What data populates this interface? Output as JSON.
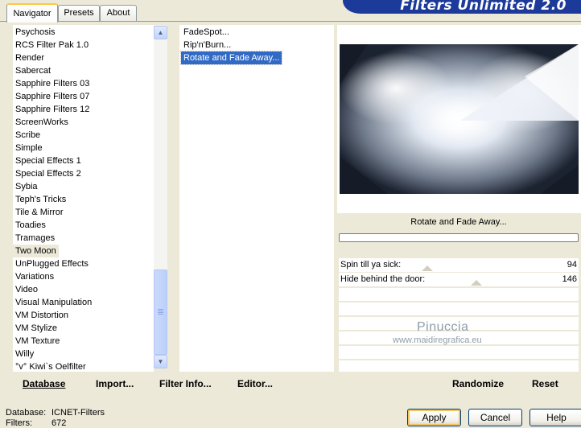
{
  "app": {
    "title": "Filters Unlimited 2.0"
  },
  "tabs": [
    {
      "label": "Navigator",
      "active": true
    },
    {
      "label": "Presets",
      "active": false
    },
    {
      "label": "About",
      "active": false
    }
  ],
  "categories": {
    "items": [
      "Psychosis",
      "RCS Filter Pak 1.0",
      "Render",
      "Sabercat",
      "Sapphire Filters 03",
      "Sapphire Filters 07",
      "Sapphire Filters 12",
      "ScreenWorks",
      "Scribe",
      "Simple",
      "Special Effects 1",
      "Special Effects 2",
      "Sybia",
      "Teph's Tricks",
      "Tile & Mirror",
      "Toadies",
      "Tramages",
      "Two Moon",
      "UnPlugged Effects",
      "Variations",
      "Video",
      "Visual Manipulation",
      "VM Distortion",
      "VM Stylize",
      "VM Texture",
      "Willy",
      "°v° Kiwi`s Oelfilter"
    ],
    "selected": "Two Moon"
  },
  "filters": {
    "items": [
      "FadeSpot...",
      "Rip'n'Burn...",
      "Rotate and Fade Away..."
    ],
    "selected": "Rotate and Fade Away..."
  },
  "preview": {
    "filter_name": "Rotate and Fade Away...",
    "progress_fraction": 0
  },
  "parameters": [
    {
      "label": "Spin till ya sick:",
      "value": "94"
    },
    {
      "label": "Hide behind the door:",
      "value": "146"
    }
  ],
  "watermark": {
    "name": "Pinuccia",
    "url": "www.maidiregrafica.eu"
  },
  "toolbar": {
    "database": "Database",
    "import": "Import...",
    "filter_info": "Filter Info...",
    "editor": "Editor...",
    "randomize": "Randomize",
    "reset": "Reset"
  },
  "status": {
    "database_label": "Database:",
    "database_value": "ICNET-Filters",
    "filters_label": "Filters:",
    "filters_value": "672"
  },
  "buttons": {
    "apply": "Apply",
    "cancel": "Cancel",
    "help": "Help"
  },
  "colors": {
    "selection": "#316ac5",
    "banner": "#1c3a9a",
    "window": "#ece9d8"
  }
}
